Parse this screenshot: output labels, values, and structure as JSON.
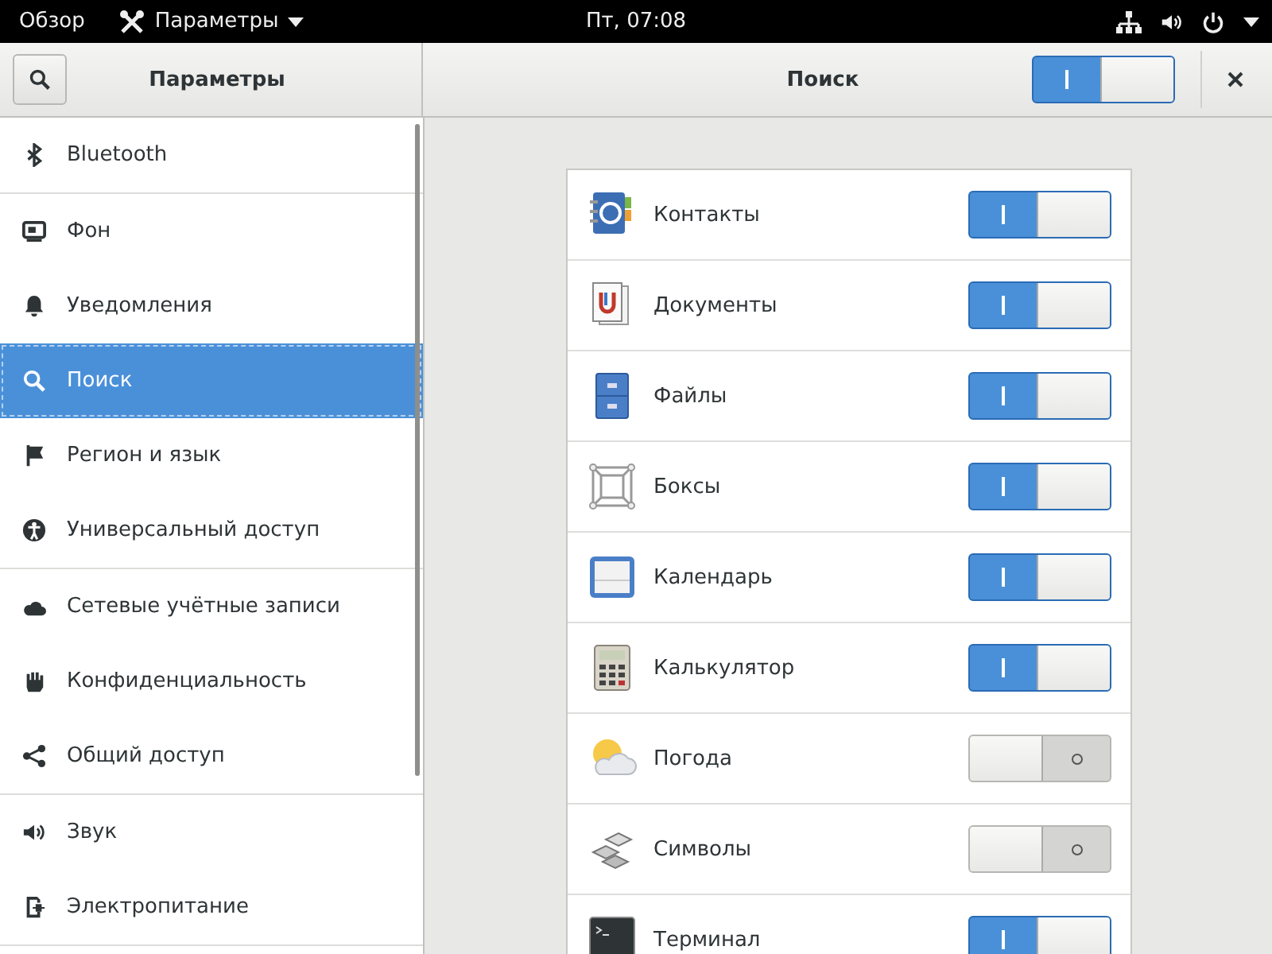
{
  "top_bar": {
    "activities": "Обзор",
    "app_menu": "Параметры",
    "clock": "Пт, 07:08"
  },
  "header": {
    "title": "Параметры",
    "panel_title": "Поиск",
    "search_switch": {
      "on": true
    }
  },
  "sidebar": {
    "sections": [
      [
        {
          "label": "Bluetooth",
          "selected": false
        }
      ],
      [
        {
          "label": "Фон",
          "selected": false
        },
        {
          "label": "Уведомления",
          "selected": false
        },
        {
          "label": "Поиск",
          "selected": true
        },
        {
          "label": "Регион и язык",
          "selected": false
        },
        {
          "label": "Универсальный доступ",
          "selected": false
        }
      ],
      [
        {
          "label": "Сетевые учётные записи",
          "selected": false
        },
        {
          "label": "Конфиденциальность",
          "selected": false
        },
        {
          "label": "Общий доступ",
          "selected": false
        }
      ],
      [
        {
          "label": "Звук",
          "selected": false
        },
        {
          "label": "Электропитание",
          "selected": false
        }
      ]
    ]
  },
  "search_providers": [
    {
      "name": "Контакты",
      "on": true
    },
    {
      "name": "Документы",
      "on": true
    },
    {
      "name": "Файлы",
      "on": true
    },
    {
      "name": "Боксы",
      "on": true
    },
    {
      "name": "Календарь",
      "on": true
    },
    {
      "name": "Калькулятор",
      "on": true
    },
    {
      "name": "Погода",
      "on": false
    },
    {
      "name": "Символы",
      "on": false
    },
    {
      "name": "Терминал",
      "on": true
    }
  ]
}
